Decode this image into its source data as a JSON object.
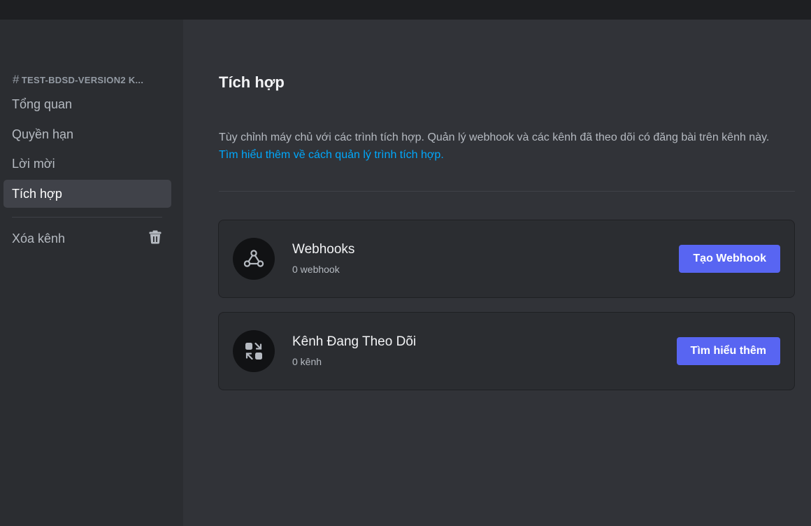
{
  "sidebar": {
    "channel_name": "TEST-BDSD-VERSION2 K...",
    "items": [
      {
        "label": "Tổng quan"
      },
      {
        "label": "Quyền hạn"
      },
      {
        "label": "Lời mời"
      },
      {
        "label": "Tích hợp"
      }
    ],
    "delete_label": "Xóa kênh"
  },
  "main": {
    "title": "Tích hợp",
    "description": "Tùy chỉnh máy chủ với các trình tích hợp. Quản lý webhook và các kênh đã theo dõi có đăng bài trên kênh này.",
    "learn_link": "Tìm hiểu thêm về cách quản lý trình tích hợp.",
    "cards": [
      {
        "title": "Webhooks",
        "count": "0 webhook",
        "button": "Tạo Webhook",
        "icon": "webhook-icon"
      },
      {
        "title": "Kênh Đang Theo Dõi",
        "count": "0 kênh",
        "button": "Tìm hiểu thêm",
        "icon": "followed-channels-icon"
      }
    ]
  },
  "colors": {
    "accent": "#5865f2",
    "link": "#00a8fc",
    "background": "#313338",
    "sidebar": "#2b2d31"
  }
}
